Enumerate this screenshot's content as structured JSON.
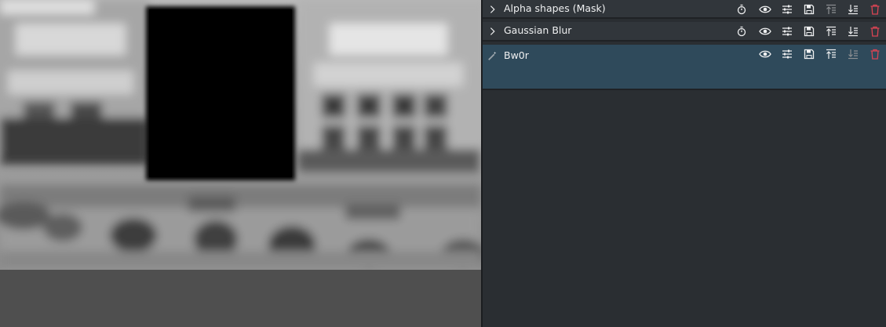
{
  "effects": [
    {
      "name": "Alpha shapes (Mask)",
      "expanded": false,
      "selected": false
    },
    {
      "name": "Gaussian Blur",
      "expanded": false,
      "selected": false
    },
    {
      "name": "Bw0r",
      "expanded": false,
      "selected": true
    }
  ],
  "icons": {
    "collapse": "chevron-right-icon",
    "keyframe": "stopwatch-icon",
    "enable": "eye-icon",
    "settings": "sliders-icon",
    "save": "floppy-save-icon",
    "move_up": "move-up-icon",
    "move_down": "move-down-icon",
    "delete": "trash-icon"
  },
  "colors": {
    "panel_bg": "#2a2e32",
    "row_bg": "#31363b",
    "selected_row_bg": "#2f4a5b",
    "text": "#eff0f1",
    "delete_icon": "#da4453"
  }
}
